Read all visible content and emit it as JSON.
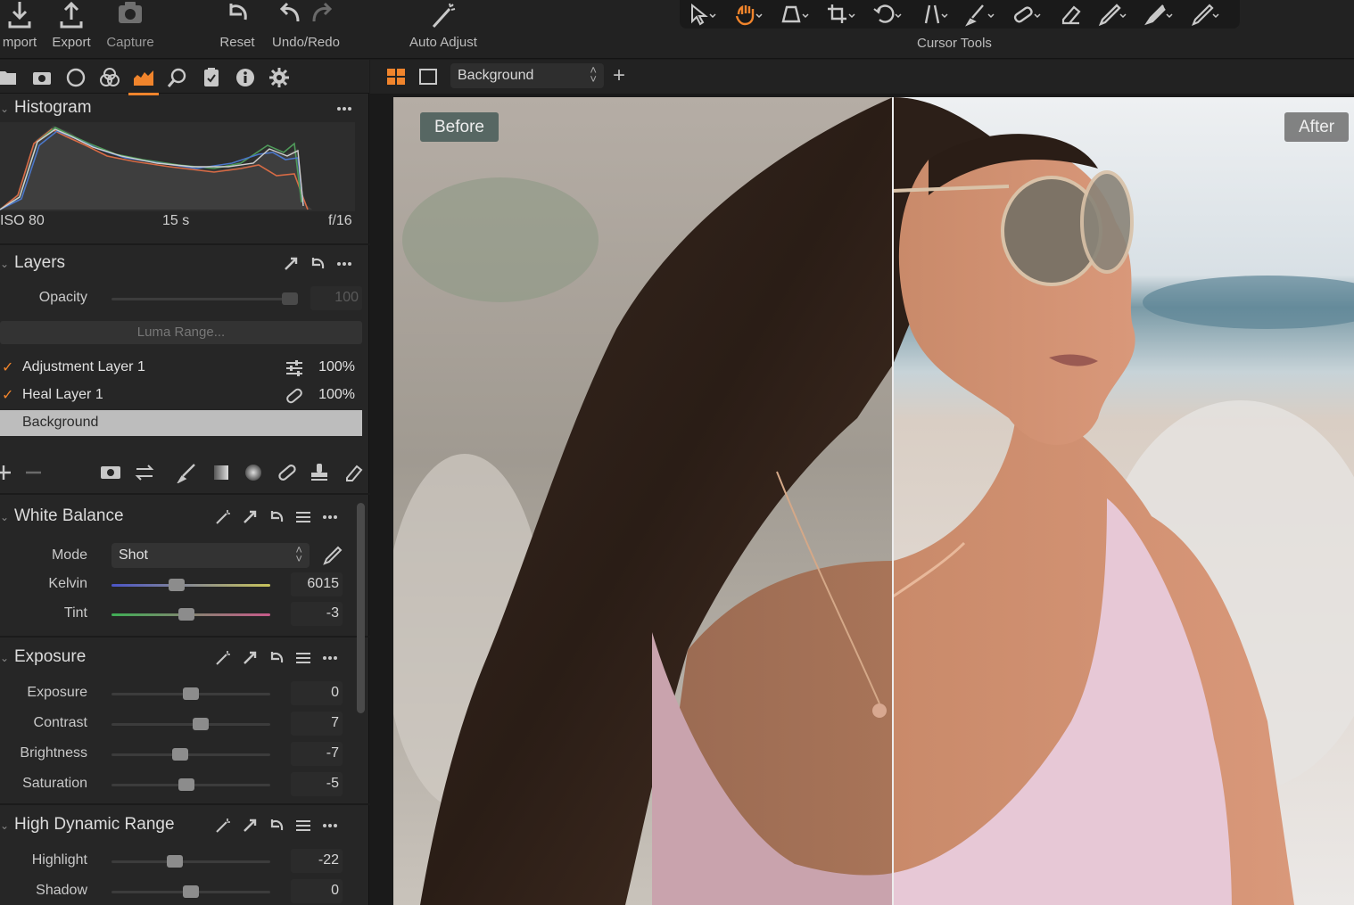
{
  "toolbar": {
    "import_label": "mport",
    "export_label": "Export",
    "capture_label": "Capture",
    "reset_label": "Reset",
    "undo_redo_label": "Undo/Redo",
    "auto_adjust_label": "Auto Adjust",
    "cursor_tools_label": "Cursor Tools"
  },
  "viewer": {
    "layer_select": "Background",
    "before_label": "Before",
    "after_label": "After"
  },
  "histogram": {
    "title": "Histogram",
    "iso": "ISO 80",
    "shutter": "15 s",
    "aperture": "f/16"
  },
  "layers": {
    "title": "Layers",
    "opacity_label": "Opacity",
    "opacity_value": "100",
    "opacity_level": 1.0,
    "luma_range_label": "Luma Range...",
    "items": [
      {
        "name": "Adjustment Layer 1",
        "opacity": "100%",
        "checked": true
      },
      {
        "name": "Heal Layer 1",
        "opacity": "100%",
        "checked": true
      },
      {
        "name": "Background",
        "opacity": "",
        "checked": false
      }
    ]
  },
  "white_balance": {
    "title": "White Balance",
    "mode_label": "Mode",
    "mode_value": "Shot",
    "kelvin_label": "Kelvin",
    "kelvin_value": "6015",
    "kelvin_level": 0.41,
    "tint_label": "Tint",
    "tint_value": "-3",
    "tint_level": 0.47
  },
  "exposure": {
    "title": "Exposure",
    "rows": [
      {
        "label": "Exposure",
        "value": "0",
        "level": 0.5
      },
      {
        "label": "Contrast",
        "value": "7",
        "level": 0.56
      },
      {
        "label": "Brightness",
        "value": "-7",
        "level": 0.43
      },
      {
        "label": "Saturation",
        "value": "-5",
        "level": 0.47
      }
    ]
  },
  "hdr": {
    "title": "High Dynamic Range",
    "rows": [
      {
        "label": "Highlight",
        "value": "-22",
        "level": 0.4
      },
      {
        "label": "Shadow",
        "value": "0",
        "level": 0.5
      }
    ]
  },
  "colors": {
    "accent": "#f0842c",
    "panel": "#262626",
    "toolbar": "#222222"
  }
}
